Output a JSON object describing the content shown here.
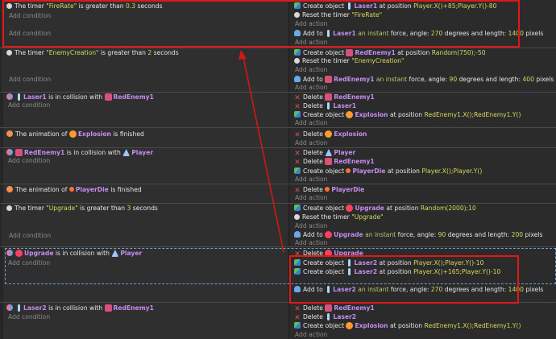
{
  "placeholders": {
    "add_condition": "Add condition",
    "add_action": "Add action"
  },
  "events": [
    {
      "conditions": [
        {
          "pre": "The timer ",
          "str": "\"FireRate\"",
          "mid": " is greater than ",
          "num": "0.3",
          "post": " seconds"
        }
      ],
      "actions": [
        {
          "verb": "Create object ",
          "obj": "Laser1",
          "text": " at position ",
          "expr": "Player.X()+85;Player.Y()-80"
        },
        {
          "verb": "Reset the timer ",
          "str": "\"FireRate\""
        },
        {
          "verb": "Add to ",
          "obj": "Laser1",
          "kw": " an instant",
          "text": " force, angle: ",
          "num1": "270",
          "text2": " degrees and length: ",
          "num2": "1400",
          "post": " pixels"
        }
      ]
    },
    {
      "conditions": [
        {
          "pre": "The timer ",
          "str": "\"EnemyCreation\"",
          "mid": " is greater than ",
          "num": "2",
          "post": " seconds"
        }
      ],
      "actions": [
        {
          "verb": "Create object ",
          "obj": "RedEnemy1",
          "text": " at position ",
          "expr": "Random(750);-50"
        },
        {
          "verb": "Reset the timer ",
          "str": "\"EnemyCreation\""
        },
        {
          "verb": "Add to ",
          "obj": "RedEnemy1",
          "kw": " an instant",
          "text": " force, angle: ",
          "num1": "90",
          "text2": " degrees and length: ",
          "num2": "400",
          "post": " pixels"
        }
      ]
    },
    {
      "conditions": [
        {
          "obj": "Laser1",
          "mid": " is in collision with ",
          "obj2": "RedEnemy1"
        }
      ],
      "actions": [
        {
          "verb": "Delete ",
          "obj": "RedEnemy1"
        },
        {
          "verb": "Delete ",
          "obj": "Laser1"
        },
        {
          "verb": "Create object ",
          "obj": "Explosion",
          "text": " at position ",
          "expr": "RedEnemy1.X();RedEnemy1.Y()"
        }
      ]
    },
    {
      "conditions": [
        {
          "pre": "The animation of ",
          "obj": "Explosion",
          "post": " is finished"
        }
      ],
      "actions": [
        {
          "verb": "Delete ",
          "obj": "Explosion"
        }
      ]
    },
    {
      "conditions": [
        {
          "obj": "RedEnemy1",
          "mid": " is in collision with ",
          "obj2": "Player"
        }
      ],
      "actions": [
        {
          "verb": "Delete ",
          "obj": "Player"
        },
        {
          "verb": "Delete ",
          "obj": "RedEnemy1"
        },
        {
          "verb": "Create object ",
          "obj": "PlayerDie",
          "text": " at position ",
          "expr": "Player.X();Player.Y()"
        }
      ]
    },
    {
      "conditions": [
        {
          "pre": "The animation of ",
          "obj": "PlayerDie",
          "post": " is finished"
        }
      ],
      "actions": [
        {
          "verb": "Delete ",
          "obj": "PlayerDie"
        }
      ]
    },
    {
      "conditions": [
        {
          "pre": "The timer ",
          "str": "\"Upgrade\"",
          "mid": " is greater than ",
          "num": "3",
          "post": " seconds"
        }
      ],
      "actions": [
        {
          "verb": "Create object ",
          "obj": "Upgrade",
          "text": " at position ",
          "expr": "Random(2000);10"
        },
        {
          "verb": "Reset the timer ",
          "str": "\"Upgrade\""
        },
        {
          "verb": "Add to ",
          "obj": "Upgrade",
          "kw": " an instant",
          "text": " force, angle: ",
          "num1": "90",
          "text2": " degrees and length: ",
          "num2": "200",
          "post": " pixels"
        }
      ]
    },
    {
      "conditions": [
        {
          "obj": "Upgrade",
          "mid": " is in collision with ",
          "obj2": "Player"
        }
      ],
      "actions": [
        {
          "verb": "Delete ",
          "obj": "Upgrade"
        },
        {
          "verb": "Create object ",
          "obj": "Laser2",
          "text": " at position ",
          "expr": "Player.X();Player.Y()-10"
        },
        {
          "verb": "Create object ",
          "obj": "Laser2",
          "text": " at position ",
          "expr": "Player.X()+165;Player.Y()-10"
        },
        {
          "verb": "Add to ",
          "obj": "Laser2",
          "kw": " an instant",
          "text": " force, angle: ",
          "num1": "270",
          "text2": " degrees and length: ",
          "num2": "1400",
          "post": " pixels"
        }
      ]
    },
    {
      "conditions": [
        {
          "obj": "Laser2",
          "mid": " is in collision with ",
          "obj2": "RedEnemy1"
        }
      ],
      "actions": [
        {
          "verb": "Delete ",
          "obj": "RedEnemy1"
        },
        {
          "verb": "Delete ",
          "obj": "Laser2"
        },
        {
          "verb": "Create object ",
          "obj": "Explosion",
          "text": " at position ",
          "expr": "RedEnemy1.X();RedEnemy1.Y()"
        }
      ]
    }
  ],
  "colors": {
    "highlight": "#e01818",
    "arrow": "#d01818",
    "object_name": "#c58cf0",
    "string_value": "#d6d95a"
  }
}
